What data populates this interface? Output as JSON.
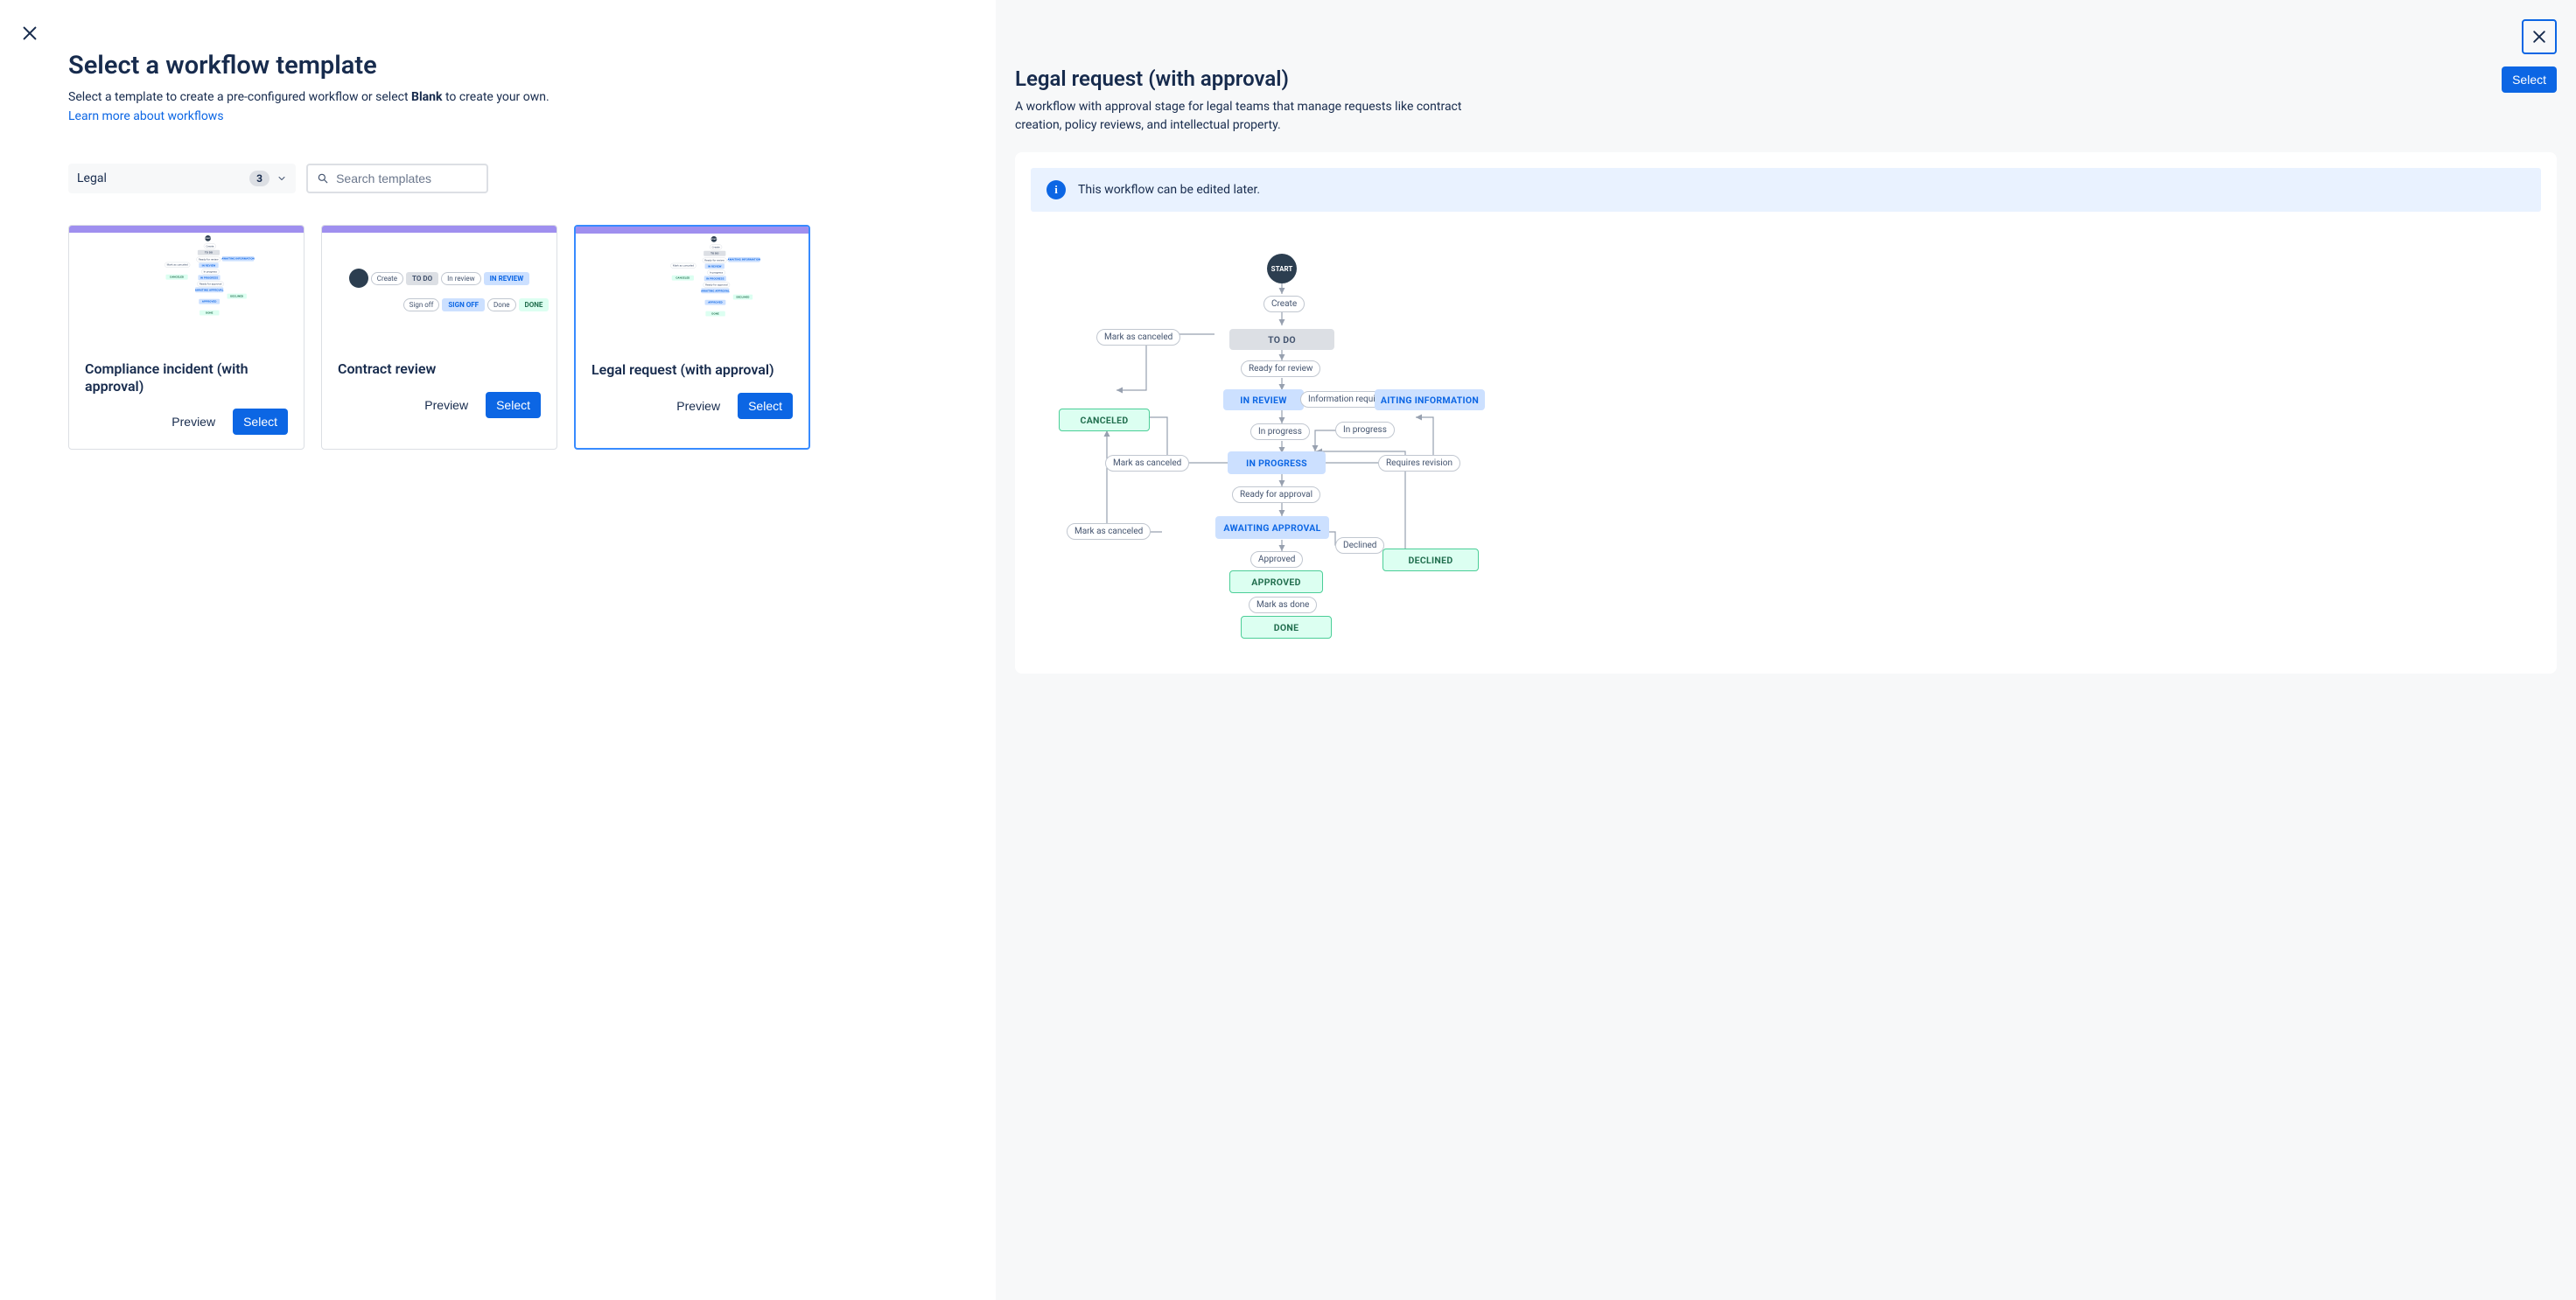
{
  "header": {
    "title": "Select a workflow template",
    "subtitle_a": "Select a template to create a pre-configured workflow or select ",
    "subtitle_bold": "Blank",
    "subtitle_b": " to create your own.",
    "learn_link": "Learn more about workflows"
  },
  "filter": {
    "label": "Legal",
    "count": "3"
  },
  "search": {
    "placeholder": "Search templates"
  },
  "buttons": {
    "preview": "Preview",
    "select": "Select"
  },
  "cards": [
    {
      "title": "Compliance incident (with approval)",
      "selected": false,
      "thumb": "legal"
    },
    {
      "title": "Contract review",
      "selected": false,
      "thumb": "contract"
    },
    {
      "title": "Legal request (with approval)",
      "selected": true,
      "thumb": "legal"
    }
  ],
  "detail": {
    "title": "Legal request (with approval)",
    "desc": "A workflow with approval stage for legal teams that manage requests like contract creation, policy reviews, and intellectual property.",
    "info": "This workflow can be edited later."
  },
  "wf": {
    "start": "START",
    "create": "Create",
    "todo": "TO DO",
    "ready_review": "Ready for review",
    "in_review": "IN REVIEW",
    "info_required": "Information required",
    "awaiting_info": "AITING INFORMATION",
    "canceled": "CANCELED",
    "mark_canceled": "Mark as canceled",
    "in_progress_pill": "In progress",
    "in_progress": "IN PROGRESS",
    "requires_revision": "Requires revision",
    "ready_approval": "Ready for approval",
    "awaiting_approval": "AWAITING APPROVAL",
    "approved_pill": "Approved",
    "approved": "APPROVED",
    "declined_pill": "Declined",
    "declined": "DECLINED",
    "mark_done": "Mark as done",
    "done": "DONE"
  }
}
